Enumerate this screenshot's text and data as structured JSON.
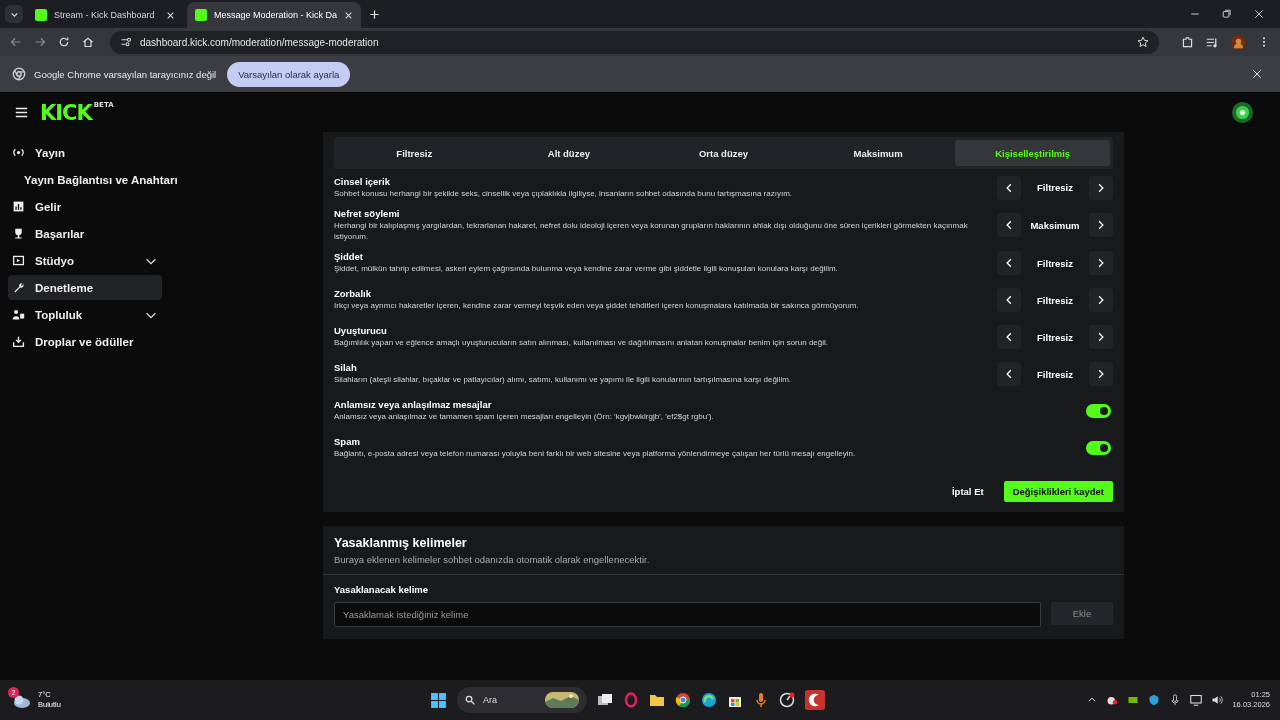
{
  "browser": {
    "tabs": [
      {
        "title": "Stream - Kick Dashboard",
        "selected": false
      },
      {
        "title": "Message Moderation - Kick Da",
        "selected": true
      }
    ],
    "url": "dashboard.kick.com/moderation/message-moderation",
    "infobar": {
      "message": "Google Chrome varsayılan tarayıcınız değil",
      "button": "Varsayılan olarak ayarla"
    }
  },
  "header": {
    "logo": "KICK",
    "logo_badge": "BETA"
  },
  "sidebar": {
    "items": [
      {
        "label": "Yayın",
        "selected": false,
        "children": [
          {
            "label": "Yayın Bağlantısı ve Anahtarı",
            "selected": false
          }
        ]
      },
      {
        "label": "Gelir",
        "selected": false
      },
      {
        "label": "Başarılar",
        "selected": false
      },
      {
        "label": "Stüdyo",
        "selected": false,
        "expanded": false
      },
      {
        "label": "Denetleme",
        "selected": true
      },
      {
        "label": "Topluluk",
        "selected": false,
        "expanded": false
      },
      {
        "label": "Droplar ve ödüller",
        "selected": false
      }
    ]
  },
  "moderation": {
    "presets": [
      {
        "label": "Filtresiz",
        "selected": false
      },
      {
        "label": "Alt düzey",
        "selected": false
      },
      {
        "label": "Orta düzey",
        "selected": false
      },
      {
        "label": "Maksimum",
        "selected": false
      },
      {
        "label": "Kişiselleştirilmiş",
        "selected": true
      }
    ],
    "categories": [
      {
        "kind": "level",
        "title": "Cinsel içerik",
        "description": "Sohbet konusu herhangi bir şekilde seks, cinsellik veya çıplaklıkla ilgiliyse, insanların sohbet odasında bunu tartışmasına razıyım.",
        "value": "Filtresiz"
      },
      {
        "kind": "level",
        "title": "Nefret söylemi",
        "description": "Herhangi bir kalıplaşmış yargılardan, tekrarlanan hakaret, nefret dolu ideoloji içeren veya korunan grupların haklarının ahlak dışı olduğunu öne süren içerikleri görmekten kaçınmak istiyorum.",
        "value": "Maksimum"
      },
      {
        "kind": "level",
        "title": "Şiddet",
        "description": "Şiddet, mülkün tahrip edilmesi, askeri eylem çağrısında bulunma veya kendine zarar verme gibi şiddetle ilgili konuşulan konulara karşı değilim.",
        "value": "Filtresiz"
      },
      {
        "kind": "level",
        "title": "Zorbalık",
        "description": "Irkçı veya ayrımcı hakaretler içeren, kendine zarar vermeyi teşvik eden veya şiddet tehditleri içeren konuşmalara katılmada bir sakınca görmüyorum.",
        "value": "Filtresiz"
      },
      {
        "kind": "level",
        "title": "Uyuşturucu",
        "description": "Bağımlılık yapan ve eğlence amaçlı uyuşturucuların satın alınması, kullanılması ve dağıtılmasını anlatan konuşmalar benim için sorun değil.",
        "value": "Filtresiz"
      },
      {
        "kind": "level",
        "title": "Silah",
        "description": "Silahların (ateşli silahlar, bıçaklar ve patlayıcılar) alımı, satımı, kullanımı ve yapımı ile ilgili konularının tartışılmasına karşı değilim.",
        "value": "Filtresiz"
      },
      {
        "kind": "toggle",
        "title": "Anlamsız veya anlaşılmaz mesajlar",
        "description": "Anlamsız veya anlaşılmaz ve tamamen spam içeren mesajları engelleyin (Örn: 'kgvjbwklrgjb', 'ef2$gt rgbu').",
        "on": true
      },
      {
        "kind": "toggle",
        "title": "Spam",
        "description": "Bağlantı, e-posta adresi veya telefon numarası yoluyla beni farklı bir web sitesine veya platforma yönlendirmeye çalışan her türlü mesajı engelleyin.",
        "on": true
      }
    ],
    "cancel": "İptal Et",
    "save": "Değişiklikleri kaydet"
  },
  "banned_words": {
    "title": "Yasaklanmış kelimeler",
    "subtitle": "Buraya eklenen kelimeler sohbet odanızda otomatik olarak engellenecektir.",
    "field_label": "Yasaklanacak kelime",
    "placeholder": "Yasaklamak istediğiniz kelime",
    "add_button": "Ekle",
    "add_disabled": true
  },
  "taskbar": {
    "weather": {
      "temperature": "7°C",
      "condition": "Bulutlu",
      "badge": "2"
    },
    "search": "Ara",
    "time": "01:25",
    "date": "16.03.2026"
  }
}
